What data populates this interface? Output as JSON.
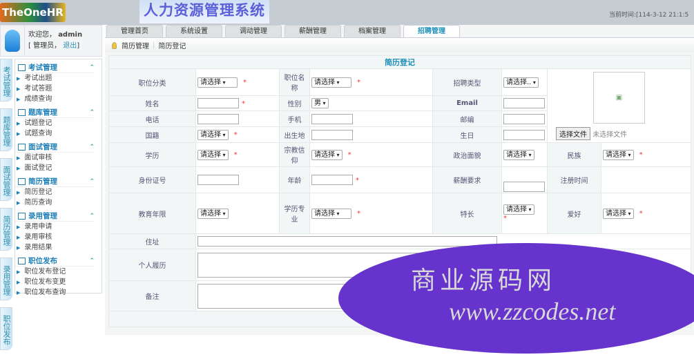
{
  "header": {
    "logo": "TheOneHR",
    "system_title": "人力资源管理系统",
    "time_label": "当前时间:[114-3-12 21:1:5"
  },
  "user": {
    "welcome": "欢迎您，",
    "name": "admin",
    "role": "[ 管理员，",
    "logout": "退出",
    "close": "]"
  },
  "vertical_tabs": [
    "考试管理",
    "题库管理",
    "面试管理",
    "简历管理",
    "录用管理",
    "职位发布"
  ],
  "menu": [
    {
      "title": "考试管理",
      "items": [
        "考试出题",
        "考试答题",
        "成绩查询"
      ]
    },
    {
      "title": "题库管理",
      "items": [
        "试题登记",
        "试题查询"
      ]
    },
    {
      "title": "面试管理",
      "items": [
        "面试审核",
        "面试登记"
      ]
    },
    {
      "title": "简历管理",
      "items": [
        "简历登记",
        "简历查询"
      ]
    },
    {
      "title": "录用管理",
      "items": [
        "录用申请",
        "录用审核",
        "录用结果"
      ]
    },
    {
      "title": "职位发布",
      "items": [
        "职位发布登记",
        "职位发布变更",
        "职位发布查询"
      ]
    }
  ],
  "tabs": [
    "管理首页",
    "系统设置",
    "调动管理",
    "薪酬管理",
    "档案管理",
    "招聘管理"
  ],
  "active_tab": "招聘管理",
  "breadcrumb": [
    "简历管理",
    "简历登记"
  ],
  "form": {
    "title": "简历登记",
    "labels": {
      "job_category": "职位分类",
      "job_name": "职位名称",
      "recruit_type": "招聘类型",
      "name": "姓名",
      "gender": "性别",
      "email": "Email",
      "phone": "电话",
      "mobile": "手机",
      "zip": "邮编",
      "nationality": "国籍",
      "birthplace": "出生地",
      "birthday": "生日",
      "education": "学历",
      "religion": "宗教信仰",
      "politics": "政治面貌",
      "ethnicity": "民族",
      "id_card": "身份证号",
      "age": "年龄",
      "salary": "薪酬要求",
      "reg_time": "注册时间",
      "edu_years": "教育年限",
      "major": "学历专业",
      "specialty": "特长",
      "hobby": "爱好",
      "address": "住址",
      "resume": "个人履历",
      "remarks": "备注"
    },
    "select_placeholder": "请选择",
    "recruit_type_value": "请选择..",
    "gender_value": "男",
    "required_mark": "*",
    "file_button": "选择文件",
    "file_status": "未选择文件"
  },
  "watermark": {
    "line1": "商业源码网",
    "line2": "www.zzcodes.net",
    "color": "#6633cc"
  }
}
